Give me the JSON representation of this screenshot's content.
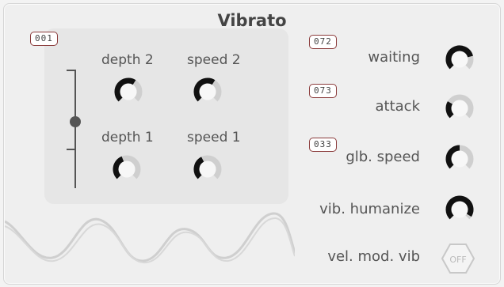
{
  "title": "Vibrato",
  "lfo_badge": "001",
  "knobs": {
    "depth2": {
      "label": "depth 2",
      "value": 0.62
    },
    "speed2": {
      "label": "speed 2",
      "value": 0.62
    },
    "depth1": {
      "label": "depth 1",
      "value": 0.42
    },
    "speed1": {
      "label": "speed 1",
      "value": 0.4
    }
  },
  "right": [
    {
      "key": "waiting",
      "label": "waiting",
      "badge": "072",
      "value": 0.78
    },
    {
      "key": "attack",
      "label": "attack",
      "badge": "073",
      "value": 0.28
    },
    {
      "key": "glb_speed",
      "label": "glb. speed",
      "badge": "033",
      "value": 0.5
    },
    {
      "key": "vib_humanize",
      "label": "vib. humanize",
      "badge": "",
      "value": 0.95
    },
    {
      "key": "vel_mod_vib",
      "label": "vel. mod. vib",
      "badge": "",
      "toggle": "OFF"
    }
  ],
  "slider": {
    "position": 0.5
  },
  "colors": {
    "knob_arc": "#111111",
    "knob_track": "#cfcfcf",
    "badge_border": "#8a3a3a"
  },
  "icons": {
    "toggle": "power-toggle",
    "wave": "wave-graphic"
  }
}
